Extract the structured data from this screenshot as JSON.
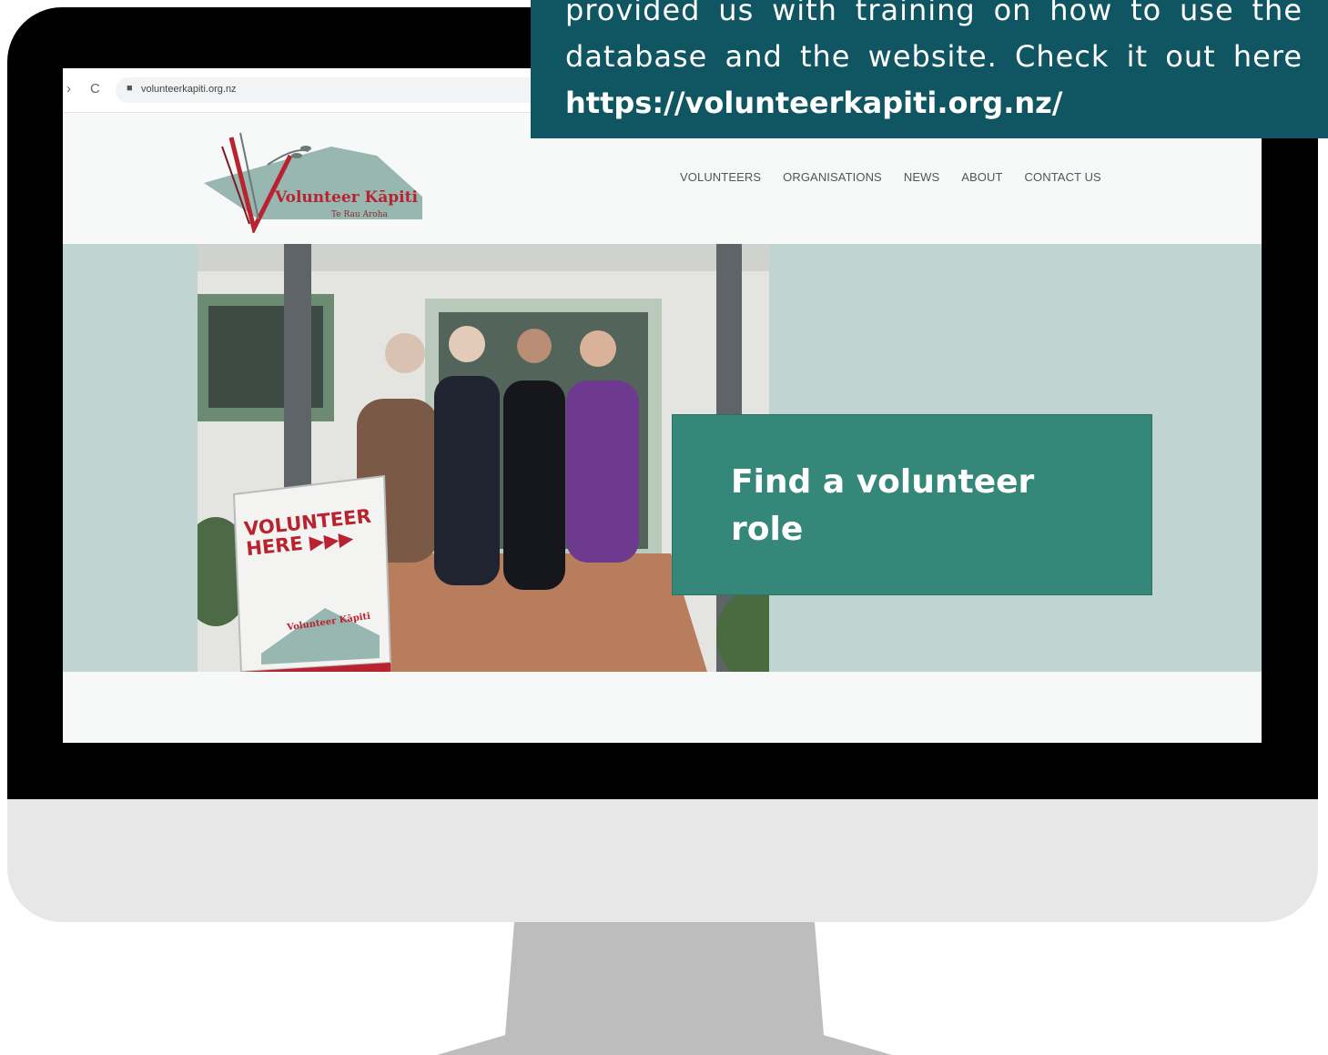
{
  "callout": {
    "text": "provided us with training on how to use the database and the website.  Check it out here ",
    "link": "https://volunteerkapiti.org.nz/"
  },
  "browser": {
    "url": "volunteerkapiti.org.nz",
    "back_icon": "chevron-left-icon",
    "reload_icon": "reload-icon",
    "lock_icon": "lock-icon"
  },
  "site": {
    "logo_title": "Volunteer Kāpiti",
    "logo_subtitle": "Te Rau Aroha",
    "nav": [
      "VOLUNTEERS",
      "ORGANISATIONS",
      "NEWS",
      "ABOUT",
      "CONTACT US"
    ]
  },
  "hero": {
    "sign_line1": "VOLUNTEER",
    "sign_line2": "HERE",
    "sign_logo": "Volunteer Kāpiti",
    "cta_label": "Find a volunteer role"
  },
  "colors": {
    "bezel": "#000000",
    "chin": "#e7e7e7",
    "stand": "#bdbdbd",
    "callout_bg": "#0f5662",
    "hero_bg": "#c0d5d1",
    "cta_bg": "#35877a",
    "logo_red": "#b8232f"
  }
}
